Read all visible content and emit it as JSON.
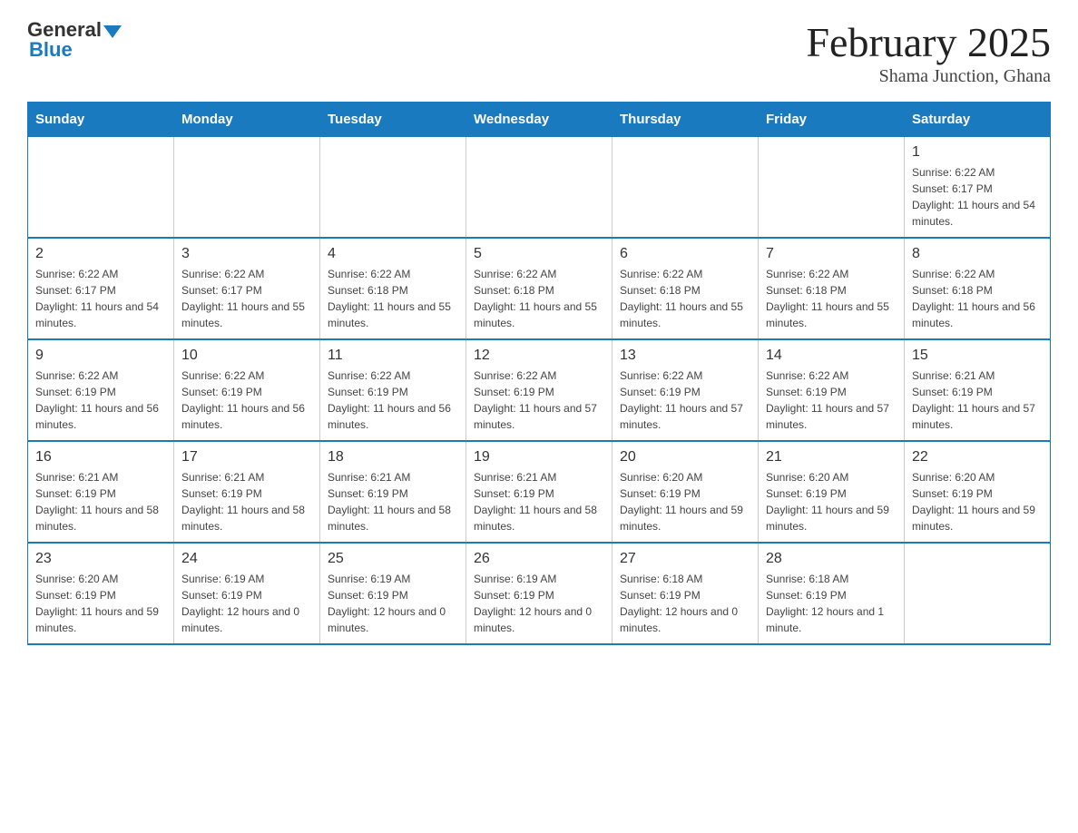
{
  "header": {
    "logo_general": "General",
    "logo_blue": "Blue",
    "title": "February 2025",
    "subtitle": "Shama Junction, Ghana"
  },
  "days_of_week": [
    "Sunday",
    "Monday",
    "Tuesday",
    "Wednesday",
    "Thursday",
    "Friday",
    "Saturday"
  ],
  "weeks": [
    {
      "days": [
        {
          "number": "",
          "empty": true
        },
        {
          "number": "",
          "empty": true
        },
        {
          "number": "",
          "empty": true
        },
        {
          "number": "",
          "empty": true
        },
        {
          "number": "",
          "empty": true
        },
        {
          "number": "",
          "empty": true
        },
        {
          "number": "1",
          "sunrise": "Sunrise: 6:22 AM",
          "sunset": "Sunset: 6:17 PM",
          "daylight": "Daylight: 11 hours and 54 minutes."
        }
      ]
    },
    {
      "days": [
        {
          "number": "2",
          "sunrise": "Sunrise: 6:22 AM",
          "sunset": "Sunset: 6:17 PM",
          "daylight": "Daylight: 11 hours and 54 minutes."
        },
        {
          "number": "3",
          "sunrise": "Sunrise: 6:22 AM",
          "sunset": "Sunset: 6:17 PM",
          "daylight": "Daylight: 11 hours and 55 minutes."
        },
        {
          "number": "4",
          "sunrise": "Sunrise: 6:22 AM",
          "sunset": "Sunset: 6:18 PM",
          "daylight": "Daylight: 11 hours and 55 minutes."
        },
        {
          "number": "5",
          "sunrise": "Sunrise: 6:22 AM",
          "sunset": "Sunset: 6:18 PM",
          "daylight": "Daylight: 11 hours and 55 minutes."
        },
        {
          "number": "6",
          "sunrise": "Sunrise: 6:22 AM",
          "sunset": "Sunset: 6:18 PM",
          "daylight": "Daylight: 11 hours and 55 minutes."
        },
        {
          "number": "7",
          "sunrise": "Sunrise: 6:22 AM",
          "sunset": "Sunset: 6:18 PM",
          "daylight": "Daylight: 11 hours and 55 minutes."
        },
        {
          "number": "8",
          "sunrise": "Sunrise: 6:22 AM",
          "sunset": "Sunset: 6:18 PM",
          "daylight": "Daylight: 11 hours and 56 minutes."
        }
      ]
    },
    {
      "days": [
        {
          "number": "9",
          "sunrise": "Sunrise: 6:22 AM",
          "sunset": "Sunset: 6:19 PM",
          "daylight": "Daylight: 11 hours and 56 minutes."
        },
        {
          "number": "10",
          "sunrise": "Sunrise: 6:22 AM",
          "sunset": "Sunset: 6:19 PM",
          "daylight": "Daylight: 11 hours and 56 minutes."
        },
        {
          "number": "11",
          "sunrise": "Sunrise: 6:22 AM",
          "sunset": "Sunset: 6:19 PM",
          "daylight": "Daylight: 11 hours and 56 minutes."
        },
        {
          "number": "12",
          "sunrise": "Sunrise: 6:22 AM",
          "sunset": "Sunset: 6:19 PM",
          "daylight": "Daylight: 11 hours and 57 minutes."
        },
        {
          "number": "13",
          "sunrise": "Sunrise: 6:22 AM",
          "sunset": "Sunset: 6:19 PM",
          "daylight": "Daylight: 11 hours and 57 minutes."
        },
        {
          "number": "14",
          "sunrise": "Sunrise: 6:22 AM",
          "sunset": "Sunset: 6:19 PM",
          "daylight": "Daylight: 11 hours and 57 minutes."
        },
        {
          "number": "15",
          "sunrise": "Sunrise: 6:21 AM",
          "sunset": "Sunset: 6:19 PM",
          "daylight": "Daylight: 11 hours and 57 minutes."
        }
      ]
    },
    {
      "days": [
        {
          "number": "16",
          "sunrise": "Sunrise: 6:21 AM",
          "sunset": "Sunset: 6:19 PM",
          "daylight": "Daylight: 11 hours and 58 minutes."
        },
        {
          "number": "17",
          "sunrise": "Sunrise: 6:21 AM",
          "sunset": "Sunset: 6:19 PM",
          "daylight": "Daylight: 11 hours and 58 minutes."
        },
        {
          "number": "18",
          "sunrise": "Sunrise: 6:21 AM",
          "sunset": "Sunset: 6:19 PM",
          "daylight": "Daylight: 11 hours and 58 minutes."
        },
        {
          "number": "19",
          "sunrise": "Sunrise: 6:21 AM",
          "sunset": "Sunset: 6:19 PM",
          "daylight": "Daylight: 11 hours and 58 minutes."
        },
        {
          "number": "20",
          "sunrise": "Sunrise: 6:20 AM",
          "sunset": "Sunset: 6:19 PM",
          "daylight": "Daylight: 11 hours and 59 minutes."
        },
        {
          "number": "21",
          "sunrise": "Sunrise: 6:20 AM",
          "sunset": "Sunset: 6:19 PM",
          "daylight": "Daylight: 11 hours and 59 minutes."
        },
        {
          "number": "22",
          "sunrise": "Sunrise: 6:20 AM",
          "sunset": "Sunset: 6:19 PM",
          "daylight": "Daylight: 11 hours and 59 minutes."
        }
      ]
    },
    {
      "days": [
        {
          "number": "23",
          "sunrise": "Sunrise: 6:20 AM",
          "sunset": "Sunset: 6:19 PM",
          "daylight": "Daylight: 11 hours and 59 minutes."
        },
        {
          "number": "24",
          "sunrise": "Sunrise: 6:19 AM",
          "sunset": "Sunset: 6:19 PM",
          "daylight": "Daylight: 12 hours and 0 minutes."
        },
        {
          "number": "25",
          "sunrise": "Sunrise: 6:19 AM",
          "sunset": "Sunset: 6:19 PM",
          "daylight": "Daylight: 12 hours and 0 minutes."
        },
        {
          "number": "26",
          "sunrise": "Sunrise: 6:19 AM",
          "sunset": "Sunset: 6:19 PM",
          "daylight": "Daylight: 12 hours and 0 minutes."
        },
        {
          "number": "27",
          "sunrise": "Sunrise: 6:18 AM",
          "sunset": "Sunset: 6:19 PM",
          "daylight": "Daylight: 12 hours and 0 minutes."
        },
        {
          "number": "28",
          "sunrise": "Sunrise: 6:18 AM",
          "sunset": "Sunset: 6:19 PM",
          "daylight": "Daylight: 12 hours and 1 minute."
        },
        {
          "number": "",
          "empty": true
        }
      ]
    }
  ]
}
